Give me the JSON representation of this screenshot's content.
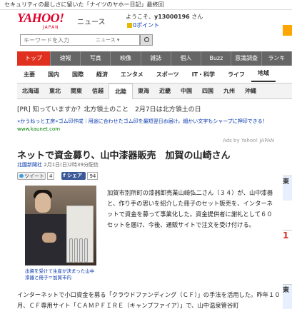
{
  "top_banner": {
    "text": "セキュリティの最しさに留いた「ナイツのヤホー日記」最終回"
  },
  "header": {
    "logo_text": "YAHOO!",
    "logo_sub": "JAPAN",
    "service_name": "ニュース",
    "welcome": "ようこそ、",
    "user_id": "y13000196",
    "honorific": "さん",
    "points": "0ポイント"
  },
  "search": {
    "placeholder": "キーワードを入力",
    "scope": "ニュース ▾"
  },
  "nav": {
    "items": [
      "トップ",
      "速報",
      "写真",
      "映像",
      "雑誌",
      "個人",
      "Buzz",
      "意識調査",
      "ランキ"
    ]
  },
  "subnav": {
    "items": [
      "主要",
      "国内",
      "国際",
      "経済",
      "エンタメ",
      "スポーツ",
      "IT・科学",
      "ライフ",
      "地域"
    ]
  },
  "regions": {
    "items": [
      "北海道",
      "東北",
      "関東",
      "信越",
      "北陸",
      "東海",
      "近畿",
      "中国",
      "四国",
      "九州",
      "沖縄"
    ]
  },
  "pr": {
    "label": "[PR]",
    "text": "知っていますか？北方領土のこと　2月7日は北方領土の日"
  },
  "ad": {
    "link": "«かうねっと工房»ゴム印作成｜用途に合わせたゴム印を最短翌日お届け。細かい文字もシャープに押印できる！",
    "url": "www.kaunet.com",
    "source": "Ads by Yahoo! JAPAN"
  },
  "article": {
    "title": "ネットで資金募り、山中漆器販売　加賀の山崎さん",
    "source": "北國新聞社",
    "date": "2月1日(日)2時39分配信",
    "tweet_label": "ツイート",
    "tweet_count": "4",
    "share_label": "シェア",
    "share_count": "94",
    "caption": "出資を受けて生産が決まった山中漆器と冊子＝加賀市内",
    "paragraph1": "加賀市別所町の漆器卸売業山崎弘二さん（３４）が、山中漆器と、作り手の思いを紹介した冊子のセット販売を、インターネットで資金を募って事業化した。資金提供者に謝礼として６０セットを届け、今後、通販サイトで注文を受け付ける。",
    "paragraph2": "インターネットで小口資金を募る「クラウドファンディング（ＣＦ）」の手法を活用した。昨年１０月、ＣＦ専用サイト「ＣＡＭＰＦＩＲＥ（キャンプファイア）」で、山中温泉管谷町"
  },
  "right_strip": {
    "labels": [
      "東",
      "1",
      "東"
    ]
  },
  "colors": {
    "nav_bg": "#666666",
    "nav_active": "#e03020",
    "logo": "#e0002a",
    "link": "#0033aa"
  }
}
